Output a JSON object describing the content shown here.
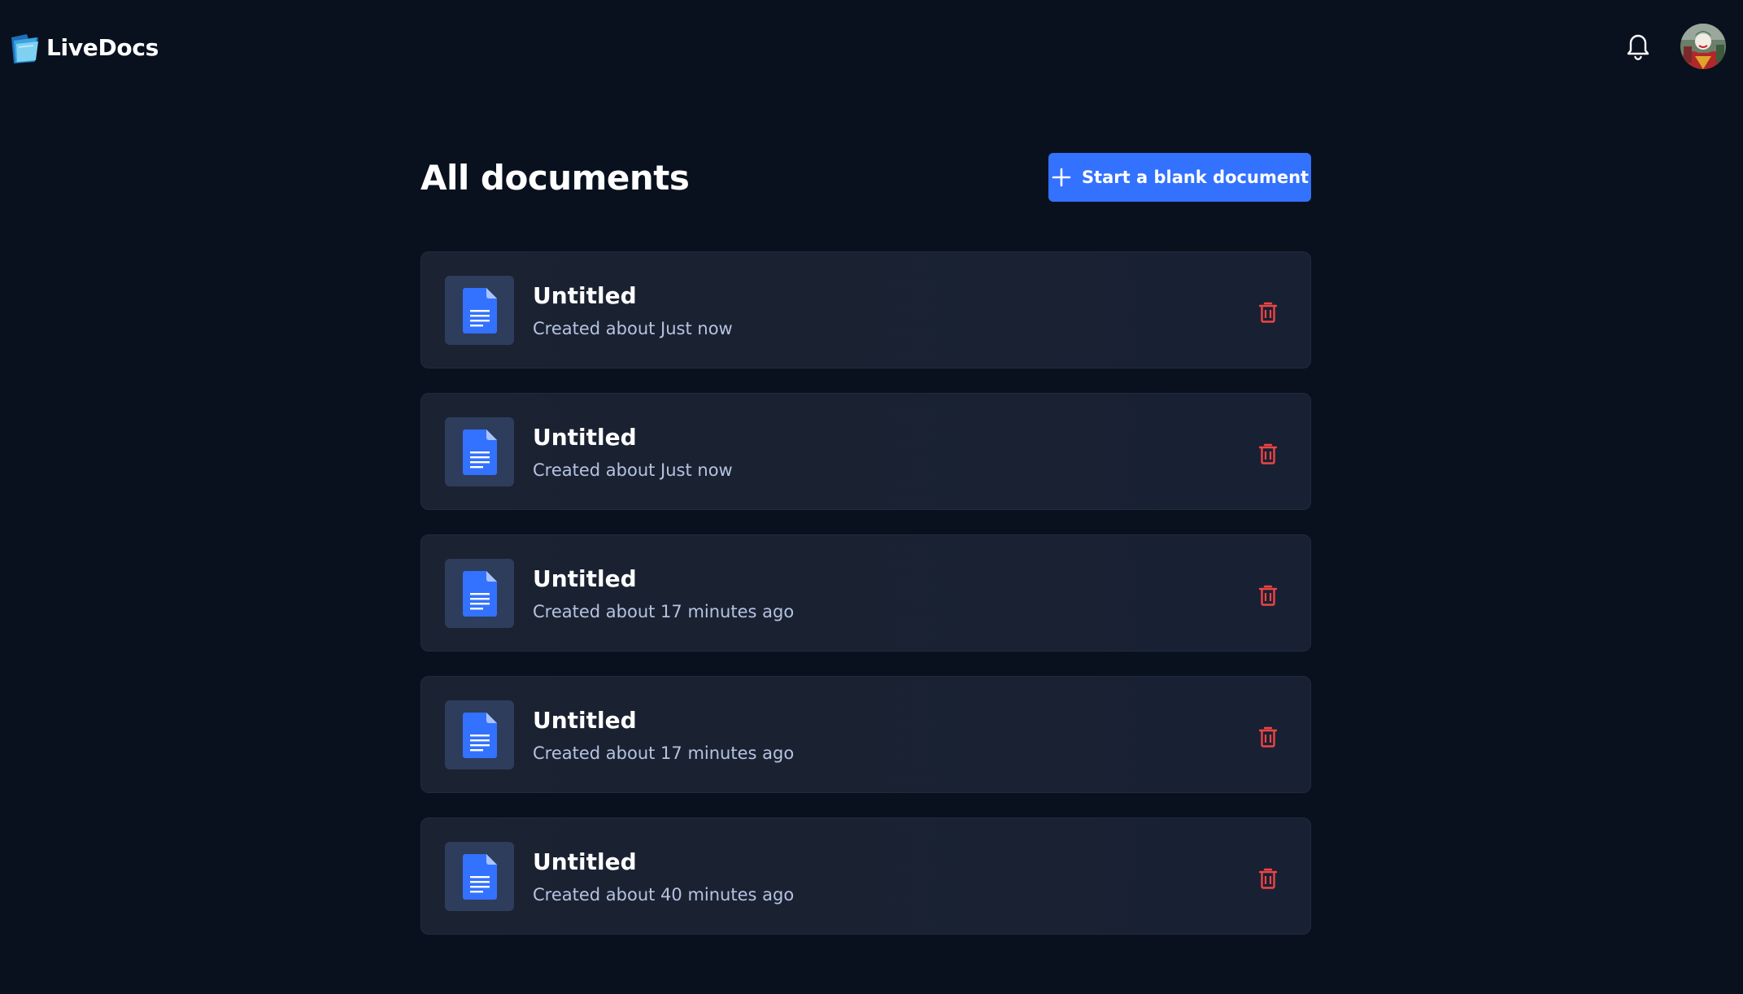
{
  "app": {
    "name": "LiveDocs"
  },
  "header": {
    "notifications_icon": "bell-icon",
    "avatar_icon": "user-avatar"
  },
  "main": {
    "title": "All documents",
    "new_button_label": "Start a blank document",
    "new_button_icon": "plus-icon",
    "documents": [
      {
        "title": "Untitled",
        "subtitle": "Created about Just now"
      },
      {
        "title": "Untitled",
        "subtitle": "Created about Just now"
      },
      {
        "title": "Untitled",
        "subtitle": "Created about 17 minutes ago"
      },
      {
        "title": "Untitled",
        "subtitle": "Created about 17 minutes ago"
      },
      {
        "title": "Untitled",
        "subtitle": "Created about 40 minutes ago"
      }
    ],
    "document_icon": "document-icon",
    "delete_icon": "trash-icon"
  },
  "colors": {
    "background": "#09111f",
    "card": "#1b2232",
    "accent": "#3371ff",
    "delete": "#ef4444",
    "subtitle": "#b5c3e0"
  }
}
